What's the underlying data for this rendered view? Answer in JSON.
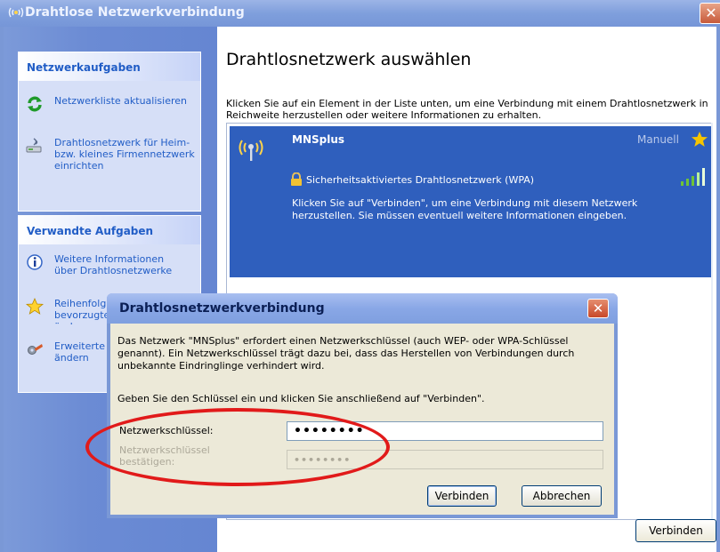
{
  "window": {
    "title": "Drahtlose Netzwerkverbindung",
    "close_glyph": "✕"
  },
  "sidebar": {
    "panel1": {
      "heading": "Netzwerkaufgaben",
      "items": [
        {
          "label": "Netzwerkliste aktualisieren",
          "icon": "refresh-icon"
        },
        {
          "label": "Drahtlosnetzwerk für Heim- bzw. kleines Firmennetzwerk einrichten",
          "icon": "wireless-setup-icon"
        }
      ]
    },
    "panel2": {
      "heading": "Verwandte Aufgaben",
      "items": [
        {
          "label": "Weitere Informationen über Drahtlosnetzwerke",
          "icon": "info-icon"
        },
        {
          "label": "Reihenfolge der bevorzugten Netzwerke ändern",
          "icon": "star-icon"
        },
        {
          "label": "Erweiterte Einstellungen ändern",
          "icon": "settings-icon"
        }
      ]
    }
  },
  "main": {
    "heading": "Drahtlosnetzwerk auswählen",
    "intro": "Klicken Sie auf ein Element in der Liste unten, um eine Verbindung mit einem Drahtlosnetzwerk in Reichweite herzustellen oder weitere Informationen zu erhalten.",
    "network": {
      "name": "MNSplus",
      "mode": "Manuell",
      "security": "Sicherheitsaktiviertes Drahtlosnetzwerk (WPA)",
      "hint": "Klicken Sie auf \"Verbinden\", um eine Verbindung mit diesem Netzwerk herzustellen. Sie müssen eventuell weitere Informationen eingeben.",
      "signal_bars": 5
    },
    "connect_label": "Verbinden"
  },
  "dialog": {
    "title": "Drahtlosnetzwerkverbindung",
    "close_glyph": "✕",
    "text1": "Das Netzwerk \"MNSplus\" erfordert einen Netzwerkschlüssel (auch WEP- oder WPA-Schlüssel genannt). Ein Netzwerkschlüssel trägt dazu bei, dass das Herstellen von Verbindungen durch unbekannte Eindringlinge verhindert wird.",
    "text2": "Geben Sie den Schlüssel ein und klicken Sie anschließend auf \"Verbinden\".",
    "key_label": "Netzwerkschlüssel:",
    "key_value": "••••••••",
    "confirm_label": "Netzwerkschlüssel bestätigen:",
    "confirm_value": "••••••••",
    "connect_label": "Verbinden",
    "cancel_label": "Abbrechen"
  },
  "colors": {
    "selection": "#2f5fbd",
    "task_link": "#215dc6",
    "annotation": "#e11a1a",
    "star": "#f5c400",
    "signal": "#6fc437"
  }
}
